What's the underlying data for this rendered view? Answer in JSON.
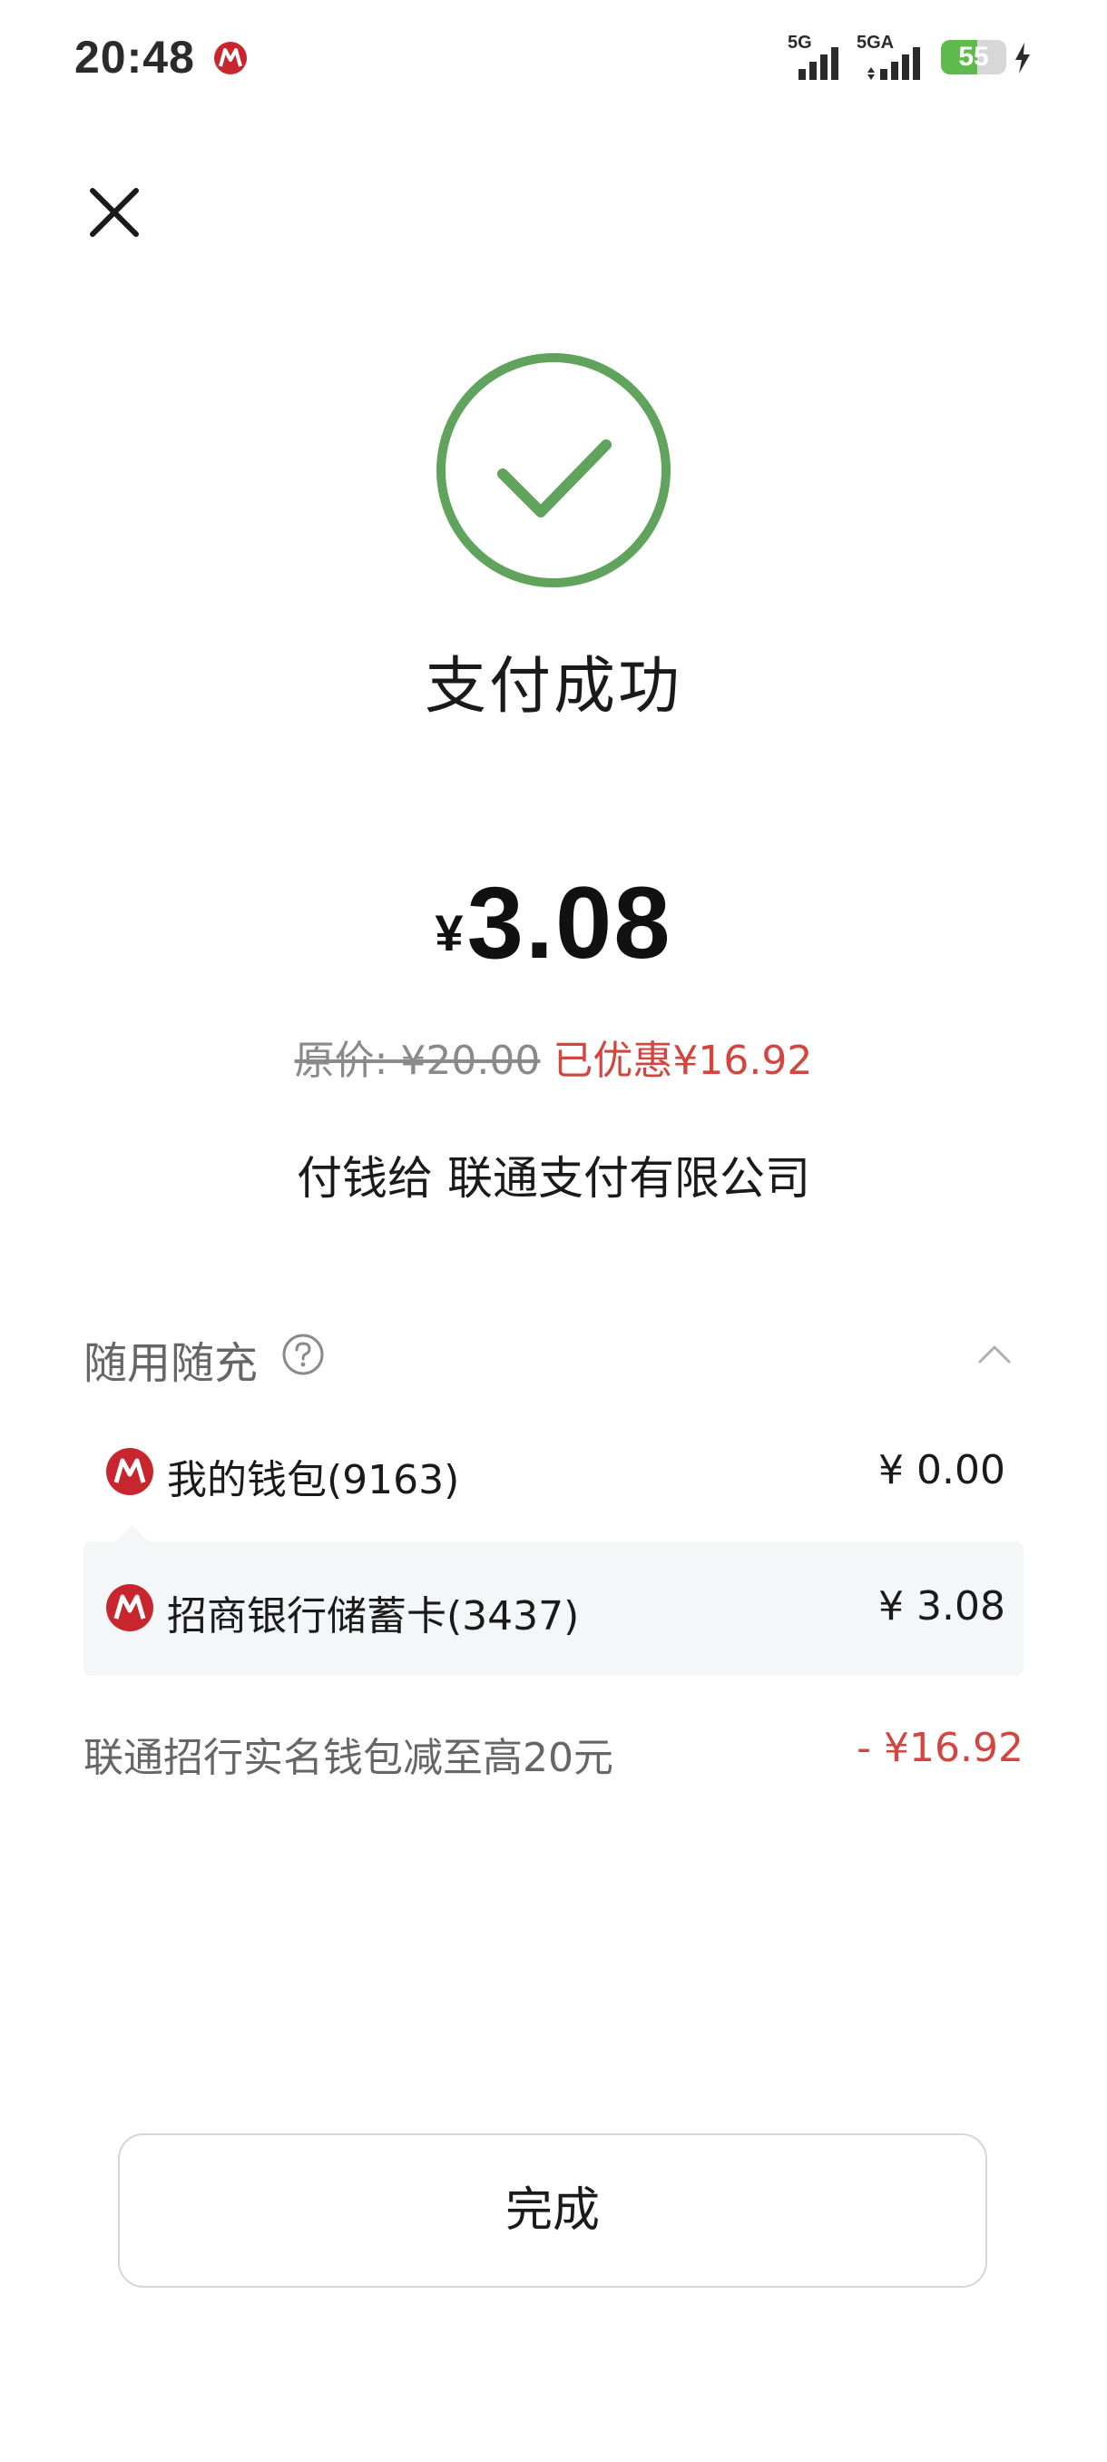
{
  "status_bar": {
    "time": "20:48",
    "network_1": "5G",
    "network_2": "5GA",
    "battery": "55",
    "battery_level": 0.55
  },
  "close_icon": "close-icon",
  "result": {
    "title": "支付成功",
    "currency": "¥",
    "amount": "3.08",
    "original_price": "原价: ¥20.00",
    "saved": "已优惠¥16.92",
    "payee": "付钱给 联通支付有限公司"
  },
  "payment": {
    "section_title": "随用随充",
    "methods": [
      {
        "name": "我的钱包(9163)",
        "amount": "¥ 0.00"
      },
      {
        "name": "招商银行储蓄卡(3437)",
        "amount": "¥ 3.08"
      }
    ],
    "discount_label": "联通招行实名钱包减至高20元",
    "discount_value": "- ¥16.92"
  },
  "done_button": "完成",
  "colors": {
    "success_green": "#5fa35d",
    "accent_red": "#d2463f",
    "bank_red": "#c8262f"
  }
}
